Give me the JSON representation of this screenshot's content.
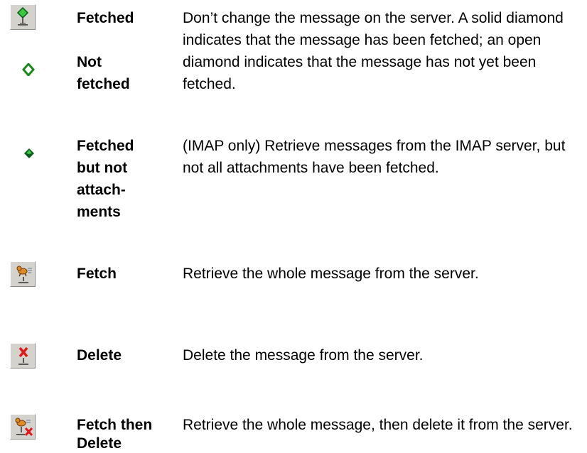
{
  "rows": [
    {
      "icon": "fetched-diamond-server-icon",
      "term_a": "Fetched",
      "term_b_line1": "Not",
      "term_b_line2": "fetched",
      "icon_b": "open-diamond-icon",
      "description": "Don’t change the message on the server. A solid diamond indicates that the message has been fetched; an open diamond indicates that the message has not yet been fetched."
    },
    {
      "icon": "solid-diamond-icon",
      "term_line1": "Fetched",
      "term_line2": "but not",
      "term_line3": "attach-",
      "term_line4": "ments",
      "description": "(IMAP only) Retrieve messages from the IMAP server, but not all attachments have been fetched."
    },
    {
      "icon": "fetch-dog-icon",
      "term": "Fetch",
      "description": "Retrieve the whole message from the server."
    },
    {
      "icon": "delete-x-icon",
      "term": "Delete",
      "description": "Delete the message from the server."
    },
    {
      "icon": "fetch-then-delete-icon",
      "term_line1": "Fetch then",
      "term_line2": "Delete",
      "description": "Retrieve the whole message, then delete it from the server."
    }
  ],
  "colors": {
    "diamond_green": "#3cc83c",
    "diamond_dark": "#0a5a1e",
    "delete_red": "#e01818",
    "dog_orange": "#e08a20",
    "button_gray": "#d4d2cc"
  }
}
